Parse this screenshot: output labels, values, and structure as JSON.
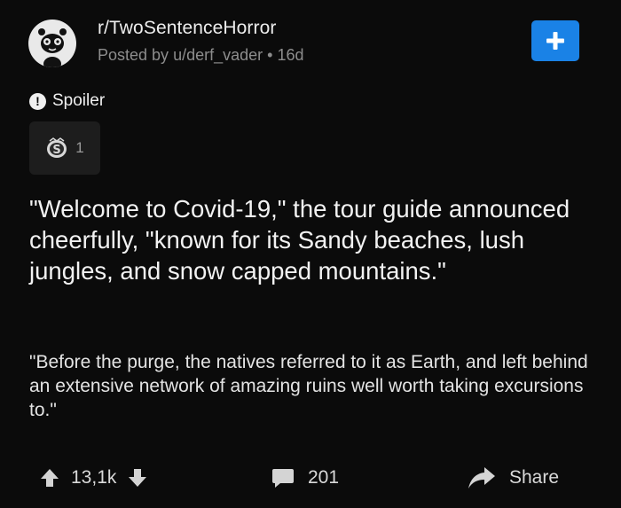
{
  "post": {
    "subreddit": "r/TwoSentenceHorror",
    "posted_by_prefix": "Posted by",
    "author": "u/derf_vader",
    "separator": "•",
    "age": "16d",
    "join_icon": "plus-icon",
    "flair": "Spoiler",
    "award_count": "1",
    "title": "\"Welcome to Covid-19,\" the tour guide announced cheerfully, \"known for its Sandy beaches, lush jungles, and snow capped mountains.\"",
    "body": "\"Before the purge, the natives referred to it as Earth, and left behind an extensive network of amazing ruins well worth taking excursions to.\""
  },
  "actions": {
    "score": "13,1k",
    "comments": "201",
    "share_label": "Share"
  },
  "colors": {
    "background": "#0b0b0b",
    "accent": "#1a82e6",
    "muted_text": "#8d8d8d"
  }
}
